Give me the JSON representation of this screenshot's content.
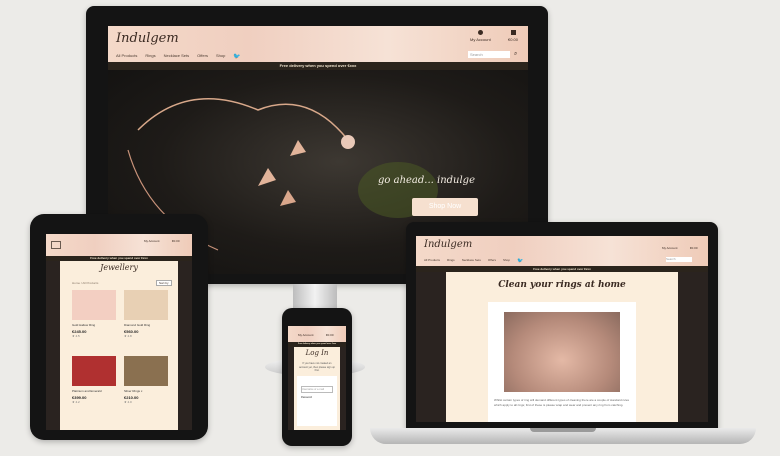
{
  "brand": {
    "logo": "Indulgem"
  },
  "nav": {
    "items": [
      "All Products",
      "Rings",
      "Necklace Sets",
      "Offers",
      "Shop"
    ],
    "account_label": "My Account",
    "bag_label": "€0.00",
    "search_placeholder": "Search"
  },
  "banner": "Free delivery when you spend over €xxx",
  "hero": {
    "tagline": "go ahead... indulge",
    "cta": "Shop Now"
  },
  "tablet": {
    "page_title": "Jewellery",
    "breadcrumb": "Home / All Products",
    "sort_label": "Sort by",
    "products": [
      {
        "name": "Gold Hallow Ring",
        "price": "€245.00",
        "rating": "★ 4.5"
      },
      {
        "name": "Diamond Gold Ring",
        "price": "€560.00",
        "rating": "★ 4.8"
      },
      {
        "name": "Platinum and Emerald",
        "price": "€399.00",
        "rating": "★ 4.2"
      },
      {
        "name": "Silver Rings x",
        "price": "€210.00",
        "rating": "★ 4.0"
      }
    ]
  },
  "phone": {
    "title": "Log In",
    "intro": "If you have not created an account yet, then please sign up first.",
    "login_field": "Username or e-mail",
    "password_label": "Password"
  },
  "laptop": {
    "article_title": "Clean your rings at home",
    "body": "Whilst certain types of ring will demand different types of cleaning there are a couple of standard rules which apply to all rings; first of these is please wrap and wear and prevent any ring from catching."
  }
}
